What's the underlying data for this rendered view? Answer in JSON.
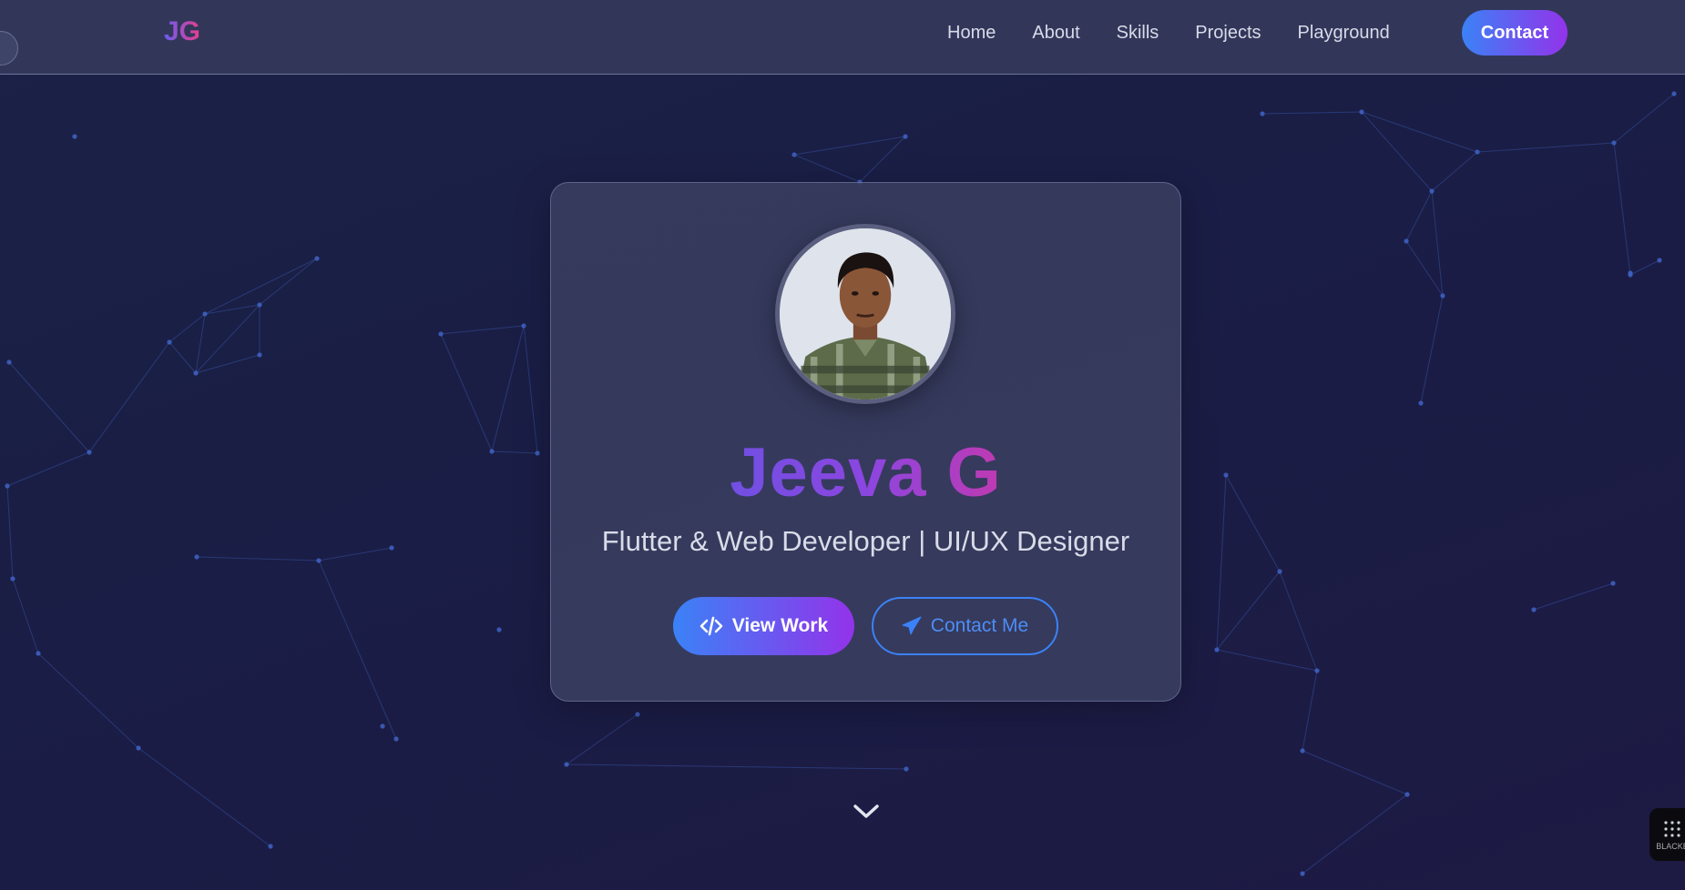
{
  "brand": {
    "logo": "JG"
  },
  "nav": {
    "items": [
      {
        "label": "Home"
      },
      {
        "label": "About"
      },
      {
        "label": "Skills"
      },
      {
        "label": "Projects"
      },
      {
        "label": "Playground"
      }
    ],
    "contact_label": "Contact"
  },
  "hero": {
    "name": "Jeeva G",
    "role": "Flutter & Web Developer | UI/UX Designer",
    "primary_button": {
      "label": "View Work",
      "icon": "code-icon"
    },
    "secondary_button": {
      "label": "Contact Me",
      "icon": "paper-plane-icon"
    },
    "scroll_icon": "chevron-down-icon"
  },
  "badge": {
    "label": "BLACKE"
  },
  "colors": {
    "accent_start": "#3b82f6",
    "accent_end": "#9333ea",
    "name_gradient_end": "#ec2f8a",
    "background": "#1a1d45",
    "network_line": "#3a5bb0"
  }
}
